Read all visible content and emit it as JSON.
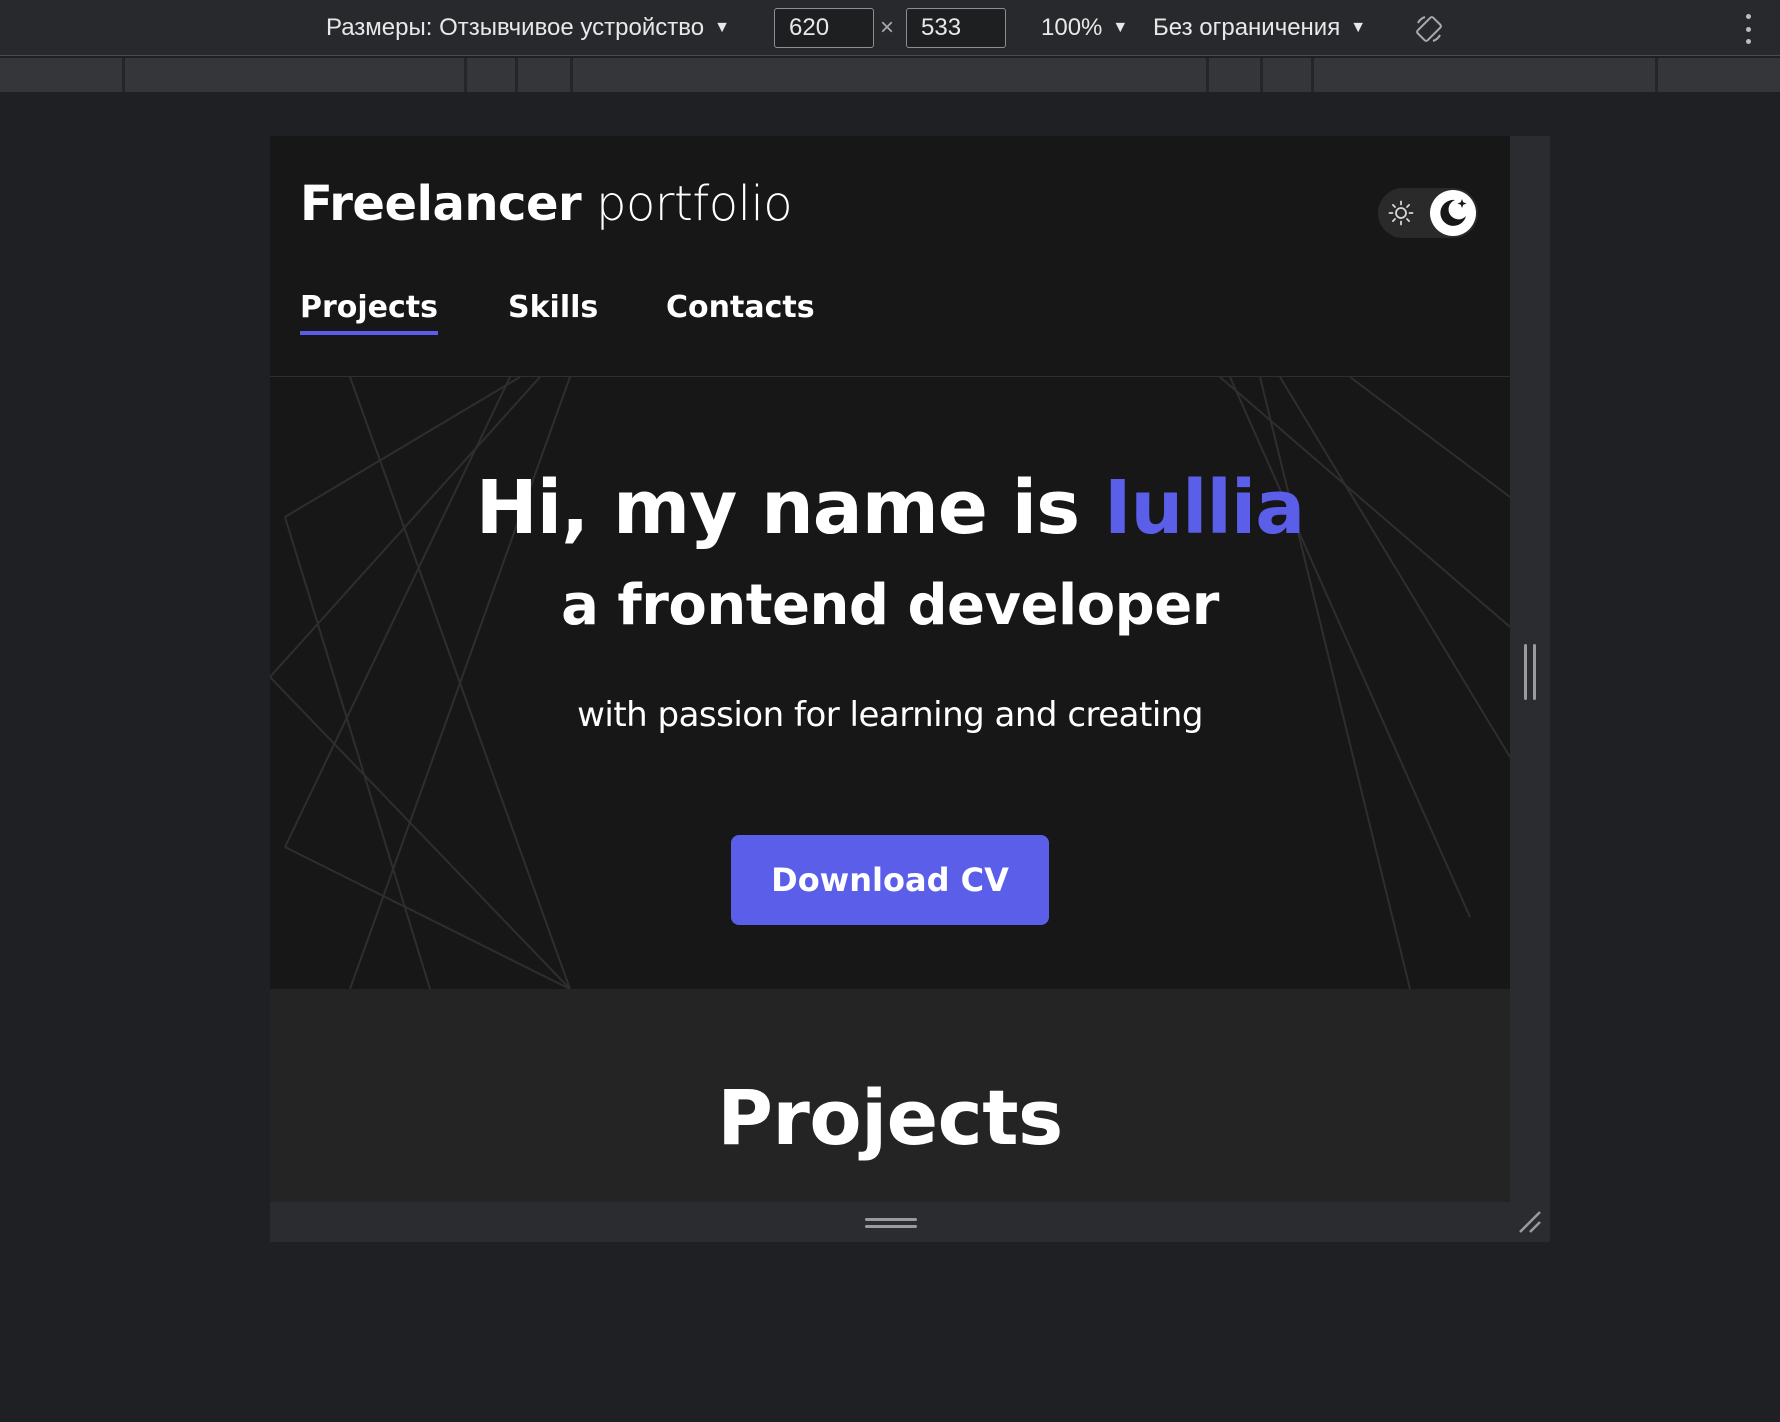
{
  "devtools": {
    "dimensions_label": "Размеры: Отзывчивое устройство",
    "width_value": "620",
    "times": "×",
    "height_value": "533",
    "zoom": "100%",
    "throttling": "Без ограничения",
    "icons": [
      "rotate-icon",
      "more-vertical-icon",
      "chevron-down-icon"
    ]
  },
  "site": {
    "logo_bold": "Freelancer",
    "logo_light": "portfolio",
    "nav": [
      {
        "label": "Projects",
        "active": true
      },
      {
        "label": "Skills",
        "active": false
      },
      {
        "label": "Contacts",
        "active": false
      }
    ],
    "theme": "dark",
    "theme_icons": [
      "sun-icon",
      "moon-icon"
    ],
    "hero": {
      "greeting": "Hi, my name is",
      "name": "Iullia",
      "role": "a frontend developer",
      "tagline": "with passion for learning and creating",
      "cta_label": "Download CV"
    },
    "projects_heading": "Projects"
  },
  "colors": {
    "accent": "#5b5ee8",
    "page_bg": "#171717",
    "section_bg": "#242424",
    "devtools_bg": "#1f2023"
  }
}
